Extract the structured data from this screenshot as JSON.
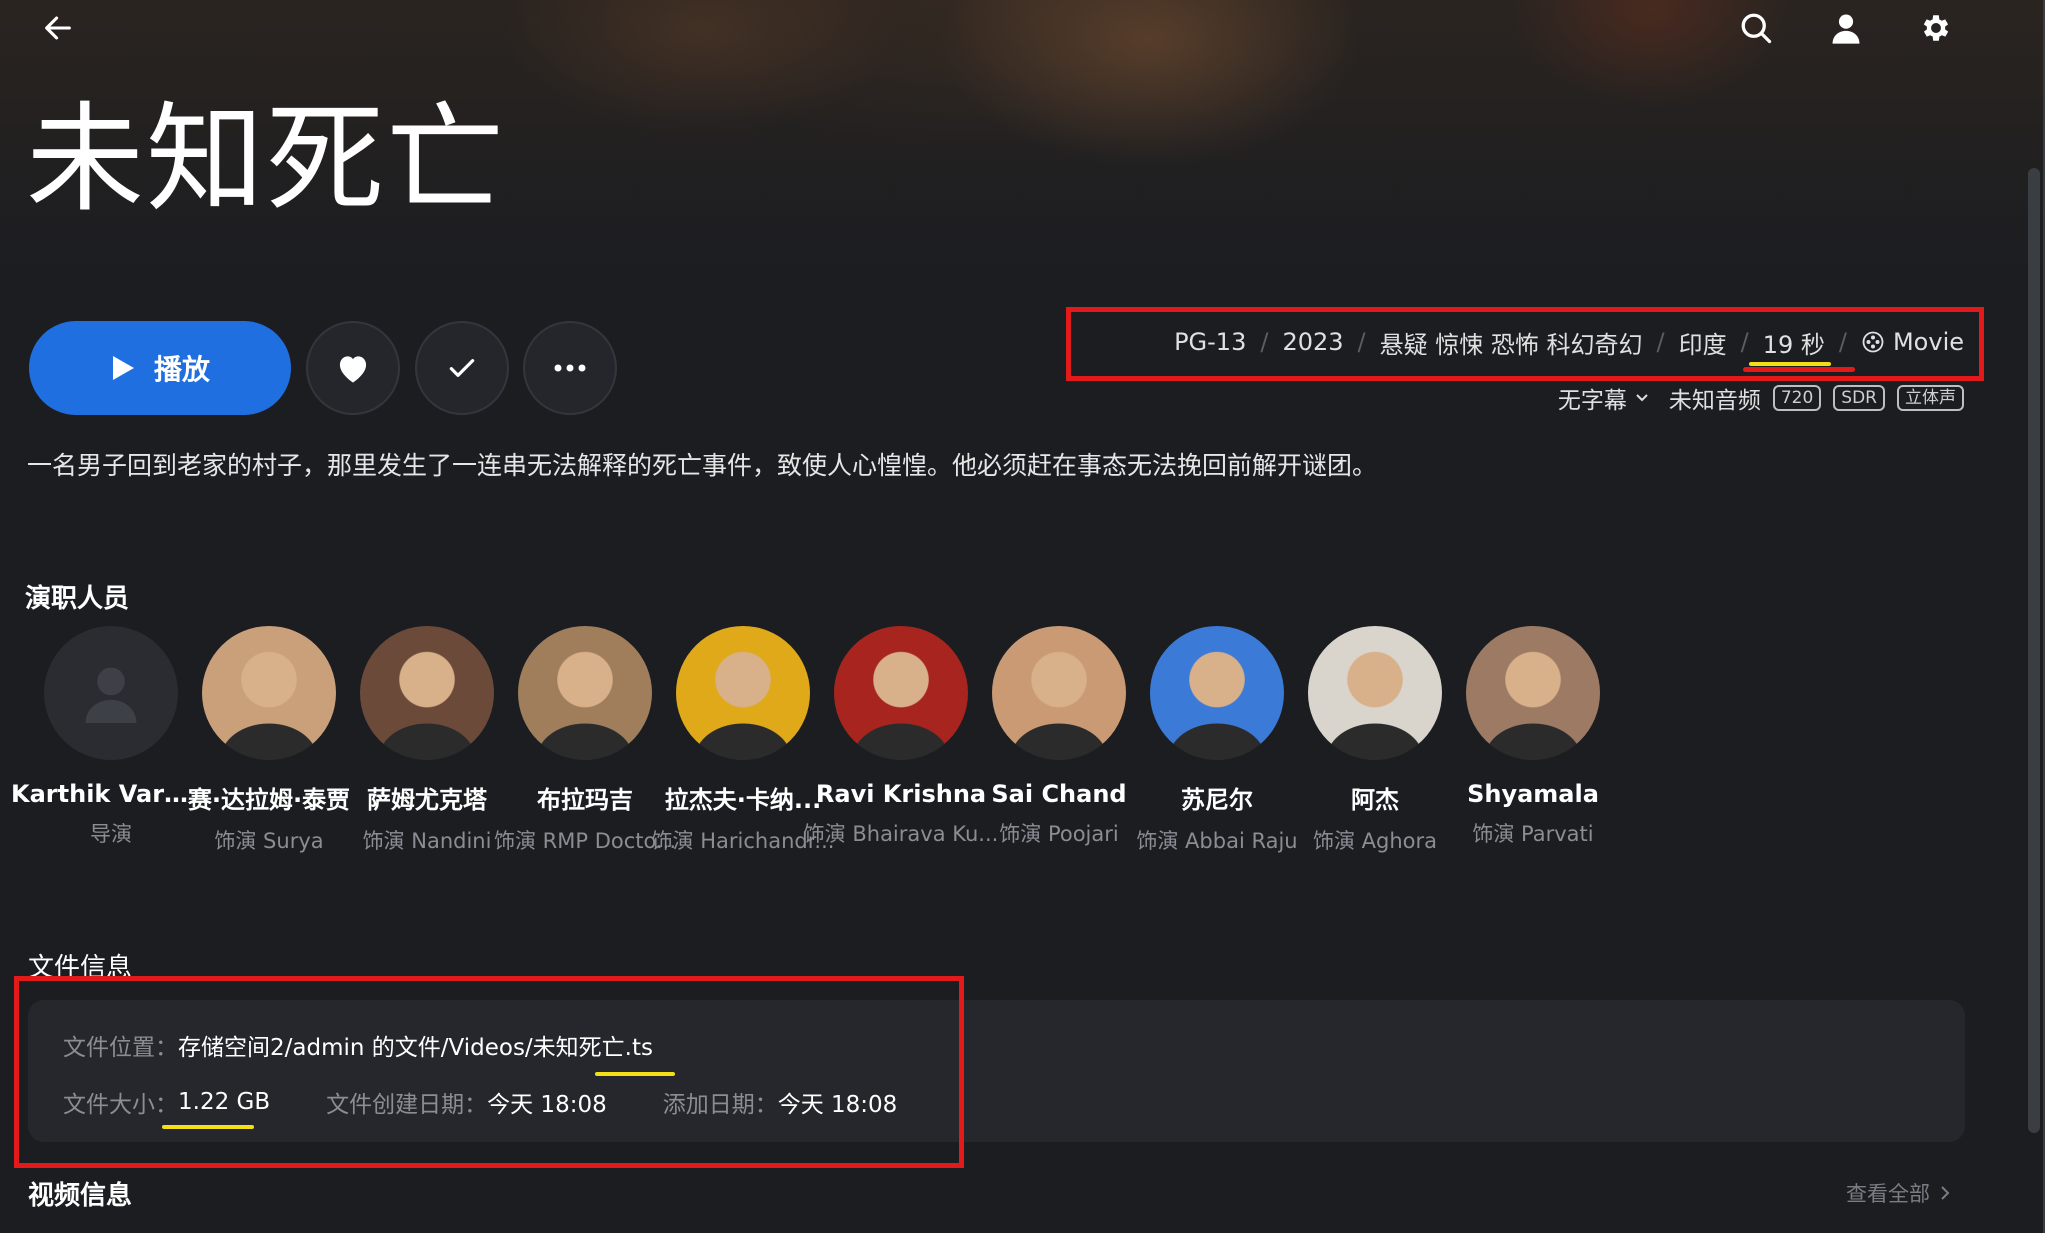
{
  "header": {
    "back_icon": "arrow-left-icon",
    "search_icon": "search-icon",
    "user_icon": "user-icon",
    "settings_icon": "gear-icon"
  },
  "title": "未知死亡",
  "actions": {
    "play_label": "播放",
    "favorite_icon": "heart-icon",
    "watched_icon": "check-icon",
    "more_icon": "more-dots-icon"
  },
  "meta": {
    "rating": "PG-13",
    "year": "2023",
    "genres": "悬疑 惊悚 恐怖 科幻奇幻",
    "country": "印度",
    "runtime": "19 秒",
    "type": "Movie"
  },
  "streams": {
    "subtitle": "无字幕",
    "audio": "未知音频",
    "resolution": "720",
    "dynamic_range": "SDR",
    "channels": "立体声"
  },
  "overview": "一名男子回到老家的村子，那里发生了一连串无法解释的死亡事件，致使人心惶惶。他必须赶在事态无法挽回前解开谜团。",
  "cast": {
    "title": "演职人员",
    "items": [
      {
        "name": "Karthik Varm...",
        "role": "导演",
        "photo": false,
        "bg": "#2a2c31"
      },
      {
        "name": "赛·达拉姆·泰贾",
        "role": "饰演 Surya",
        "photo": true,
        "bg": "#c9a07a"
      },
      {
        "name": "萨姆尤克塔",
        "role": "饰演 Nandini",
        "photo": true,
        "bg": "#6b4a3a"
      },
      {
        "name": "布拉玛吉",
        "role": "饰演 RMP Docto...",
        "photo": true,
        "bg": "#a07e5c"
      },
      {
        "name": "拉杰夫·卡纳...",
        "role": "饰演 Harichandr...",
        "photo": true,
        "bg": "#e0a91a"
      },
      {
        "name": "Ravi Krishna",
        "role": "饰演 Bhairava Ku...",
        "photo": true,
        "bg": "#a8241e"
      },
      {
        "name": "Sai Chand",
        "role": "饰演 Poojari",
        "photo": true,
        "bg": "#c99a74"
      },
      {
        "name": "苏尼尔",
        "role": "饰演 Abbai Raju",
        "photo": true,
        "bg": "#3b7ad6"
      },
      {
        "name": "阿杰",
        "role": "饰演 Aghora",
        "photo": true,
        "bg": "#d9d4cc"
      },
      {
        "name": "Shyamala",
        "role": "饰演 Parvati",
        "photo": true,
        "bg": "#9c7a64"
      }
    ]
  },
  "file_info": {
    "title": "文件信息",
    "location_label": "文件位置：",
    "location_value": "存储空间2/admin 的文件/Videos/未知死亡.ts",
    "size_label": "文件大小：",
    "size_value": "1.22 GB",
    "created_label": "文件创建日期：",
    "created_value": "今天 18:08",
    "added_label": "添加日期：",
    "added_value": "今天 18:08"
  },
  "video_info": {
    "title": "视频信息",
    "view_all": "查看全部"
  },
  "colors": {
    "accent": "#1f6fe0",
    "annotation_red": "#e21a1a",
    "annotation_yellow": "#f2df17",
    "background": "#1b1d21"
  }
}
